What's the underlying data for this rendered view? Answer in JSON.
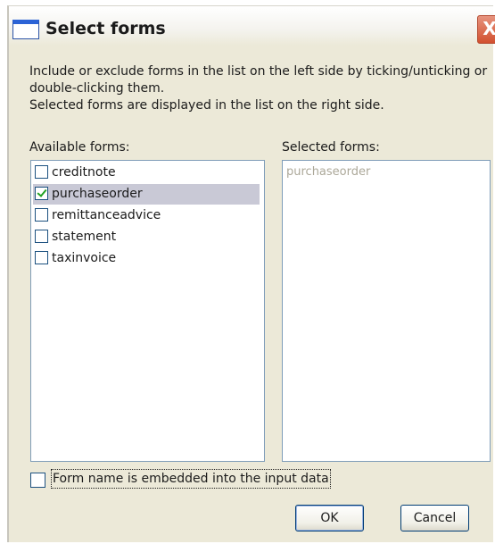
{
  "window": {
    "title": "Select forms",
    "close_glyph": "X"
  },
  "description": {
    "line1": "Include or exclude forms in the list on the left side by ticking/unticking or",
    "line2": "double-clicking them.",
    "line3": "Selected forms are displayed in the list on the right side."
  },
  "available": {
    "label": "Available forms:",
    "items": [
      {
        "label": "creditnote",
        "checked": false,
        "selected": false
      },
      {
        "label": "purchaseorder",
        "checked": true,
        "selected": true
      },
      {
        "label": "remittanceadvice",
        "checked": false,
        "selected": false
      },
      {
        "label": "statement",
        "checked": false,
        "selected": false
      },
      {
        "label": "taxinvoice",
        "checked": false,
        "selected": false
      }
    ]
  },
  "selected": {
    "label": "Selected forms:",
    "items": [
      "purchaseorder"
    ]
  },
  "embed_option": {
    "label": "Form name is embedded into the input data",
    "checked": false
  },
  "buttons": {
    "ok": "OK",
    "cancel": "Cancel"
  },
  "colors": {
    "dialog_bg": "#ece9d8",
    "list_border": "#7f9db9",
    "selection_bg": "#c9c9d6",
    "check_mark": "#21a121",
    "disabled_text": "#aca899",
    "close_button": "#d2502f"
  },
  "icons": {
    "title": "window-icon",
    "close": "close-icon",
    "check": "checkmark-icon"
  }
}
